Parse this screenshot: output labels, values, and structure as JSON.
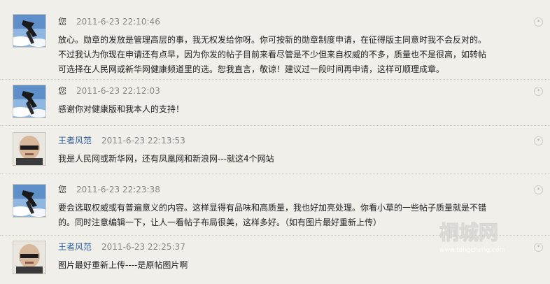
{
  "posts": [
    {
      "author": "您",
      "time": "2011-6-23 22:10:46",
      "avatar": "sky-ravens-avatar",
      "lines": [
        "放心。勋章的发放是管理高层的事，我无权发给你呀。你可按新的勋章制度申请，在征得版主同意时我不会反对的。",
        "不过我认为你现在申请还有点早，因为你发的帖子目前来看尽管是不少但来自权威的不多，质量也不是很高，如转帖",
        "可选择在人民网或新华网健康频道里的选。恕我直言，敬谅！建议过一段时间再申请，这样可顺理成章。"
      ]
    },
    {
      "author": "您",
      "time": "2011-6-23 22:12:03",
      "avatar": "sky-ravens-avatar",
      "lines": [
        "感谢你对健康版和我本人的支持！"
      ]
    },
    {
      "author": "王者风范",
      "time": "2011-6-23 22:13:53",
      "avatar": "bald-man-avatar",
      "lines": [
        "我是人民网或新华网，还有凤凰网和新浪网---就这4个网站"
      ]
    },
    {
      "author": "您",
      "time": "2011-6-23 22:23:38",
      "avatar": "sky-ravens-avatar",
      "lines": [
        "要会选取权威或有普遍意义的内容。这样显得有品味和高质量，我也好加亮处理。你看小草的一些帖子质量就是不错",
        "的。同时注意编辑一下，让人一看帖子布局很美，这样多好。（如有图片最好重新上传）"
      ]
    },
    {
      "author": "王者风范",
      "time": "2011-6-23 22:25:37",
      "avatar": "bald-man-avatar",
      "lines": [
        "图片最好重新上传----是原帖图片啊"
      ]
    }
  ],
  "watermark": {
    "title": "桐城网",
    "url": "www.tongcheng.com"
  },
  "colors": {
    "background": "#f1efe9",
    "author_link": "#2a5b9c",
    "timestamp": "#888888",
    "divider": "#d2cfc6"
  }
}
